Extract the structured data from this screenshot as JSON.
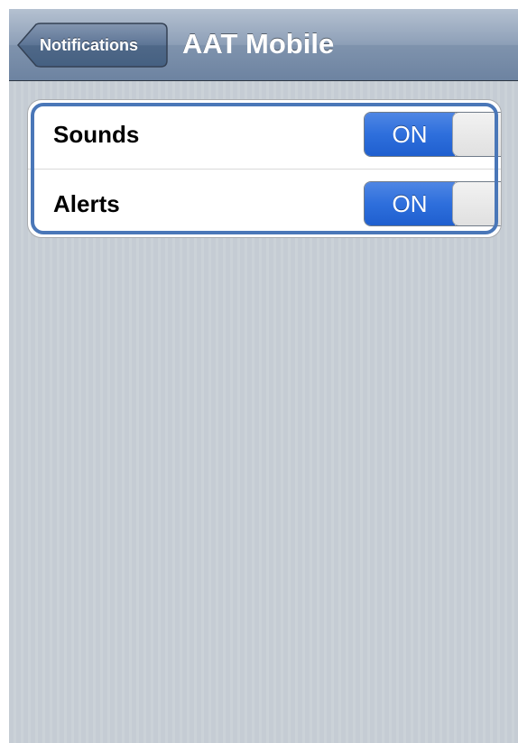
{
  "nav": {
    "back_label": "Notifications",
    "title": "AAT Mobile"
  },
  "settings": [
    {
      "label": "Sounds",
      "state": "ON",
      "enabled": true
    },
    {
      "label": "Alerts",
      "state": "ON",
      "enabled": true
    }
  ],
  "colors": {
    "navbar": "#8d9fb7",
    "toggle_on": "#2e6fdc",
    "background": "#c5ccd4",
    "selection": "#4a77b8"
  }
}
